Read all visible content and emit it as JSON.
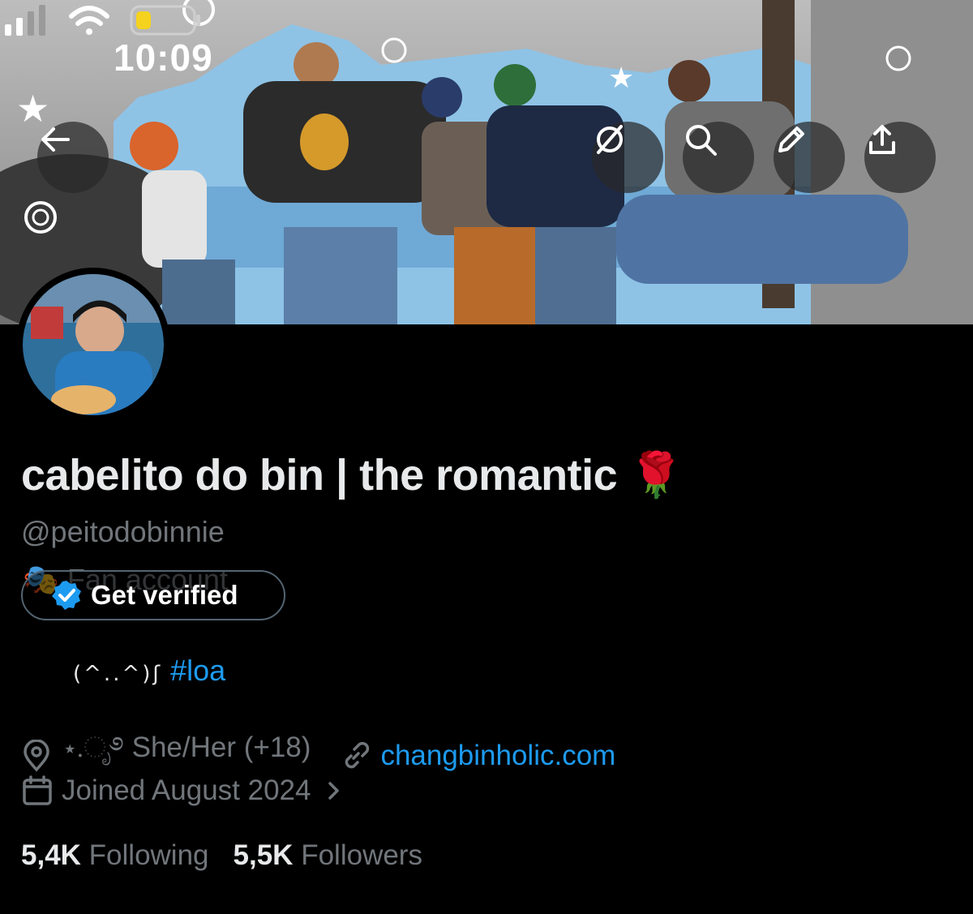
{
  "status_bar": {
    "time": "10:09"
  },
  "header_actions": {
    "back": "back-arrow-icon",
    "grok": "grok-icon",
    "search": "search-icon",
    "edit": "pencil-icon",
    "share": "share-icon"
  },
  "profile": {
    "display_name": "cabelito do bin | the romantic 🌹",
    "handle": "@peitodobinnie",
    "category": "🎭 Fan account",
    "get_verified_label": "Get verified",
    "bio_kaomoji": "(^..^)ʃ",
    "bio_hashtag": "#loa",
    "location": "⋆.ೃ࿔ She/Her (+18)",
    "website": "changbinholic.com",
    "joined": "Joined August 2024",
    "following_count": "5,4K",
    "following_label": "Following",
    "followers_count": "5,5K",
    "followers_label": "Followers"
  },
  "colors": {
    "background": "#000000",
    "text_primary": "#e7e9ea",
    "text_secondary": "#71767b",
    "link": "#1d9bf0",
    "verified_badge": "#1d9bf0"
  }
}
